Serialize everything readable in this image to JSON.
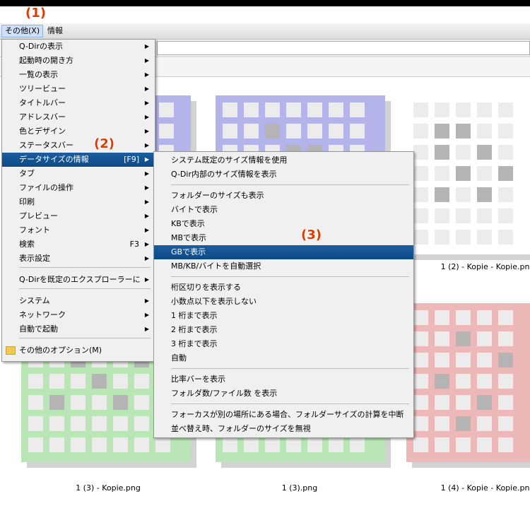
{
  "menubar": {
    "items": [
      "その他(X)",
      "情報"
    ]
  },
  "badges": [
    "(1)",
    "(2)",
    "(3)"
  ],
  "main_menu": {
    "items": [
      {
        "label": "Q-Dirの表示",
        "shortcut": "",
        "sub": true
      },
      {
        "label": "起動時の開き方",
        "shortcut": "",
        "sub": true
      },
      {
        "label": "一覧の表示",
        "shortcut": "",
        "sub": true
      },
      {
        "label": "ツリービュー",
        "shortcut": "",
        "sub": true
      },
      {
        "label": "タイトルバー",
        "shortcut": "",
        "sub": true
      },
      {
        "label": "アドレスバー",
        "shortcut": "",
        "sub": true
      },
      {
        "label": "色とデザイン",
        "shortcut": "",
        "sub": true
      },
      {
        "label": "ステータスバー",
        "shortcut": "",
        "sub": true
      },
      {
        "label": "データサイズの情報",
        "shortcut": "[F9]",
        "sub": true
      },
      {
        "label": "タブ",
        "shortcut": "",
        "sub": true
      },
      {
        "label": "ファイルの操作",
        "shortcut": "",
        "sub": true
      },
      {
        "label": "印刷",
        "shortcut": "",
        "sub": true
      },
      {
        "label": "プレビュー",
        "shortcut": "",
        "sub": true
      },
      {
        "label": "フォント",
        "shortcut": "",
        "sub": true
      },
      {
        "label": "検索",
        "shortcut": "F3",
        "sub": true
      },
      {
        "label": "表示設定",
        "shortcut": "",
        "sub": true
      },
      {
        "label": "Q-Dirを既定のエクスプローラーに",
        "shortcut": "",
        "sub": true
      },
      {
        "label": "システム",
        "shortcut": "",
        "sub": true
      },
      {
        "label": "ネットワーク",
        "shortcut": "",
        "sub": true
      },
      {
        "label": "自動で起動",
        "shortcut": "",
        "sub": true
      },
      {
        "label": "その他のオプション(M)",
        "shortcut": "",
        "sub": false
      }
    ]
  },
  "sub_menu": {
    "items": [
      "システム既定のサイズ情報を使用",
      "Q-Dir内部のサイズ情報を表示",
      "フォルダーのサイズも表示",
      "バイトで表示",
      "KBで表示",
      "MBで表示",
      "GBで表示",
      "MB/KB/バイトを自動選択",
      "桁区切りを表示する",
      "小数点以下を表示しない",
      "1 桁まで表示",
      "2 桁まで表示",
      "3 桁まで表示",
      "自動",
      "比率バーを表示",
      "フォルダ数/ファイル数 を表示",
      "フォーカスが別の場所にある場合、フォルダーサイズの計算を中断",
      "並べ替え時、フォルダーのサイズを無視"
    ]
  },
  "files": [
    "1 (2) - Kopie - Kopie.png",
    "1 (3) - Kopie.png",
    "1 (3).png",
    "1 (4) - Kopie - Kopie.png"
  ],
  "colors": {
    "blue": "#b4b4ea",
    "gray": "#b4b4b4",
    "green": "#b9e6b4",
    "red": "#ecb8b8",
    "highlight": "#0f4d8a",
    "badge": "#e03a00"
  }
}
